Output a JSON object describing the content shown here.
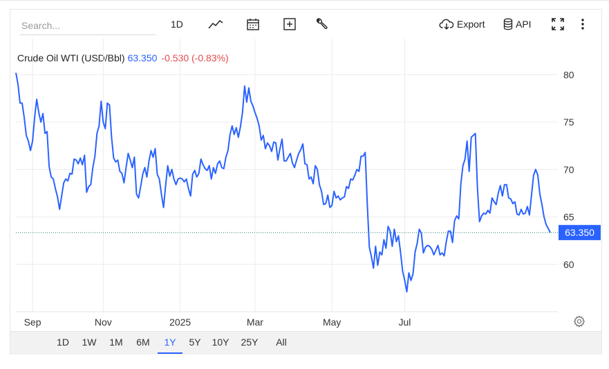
{
  "toolbar": {
    "search_placeholder": "Search...",
    "interval_label": "1D",
    "export_label": "Export",
    "api_label": "API",
    "icons": [
      "line-chart-icon",
      "calendar-icon",
      "add-indicator-icon",
      "wrench-icon",
      "cloud-download-icon",
      "database-icon",
      "fullscreen-icon",
      "more-vertical-icon"
    ]
  },
  "legend": {
    "name": "Crude Oil WTI (USD/Bbl)",
    "price": "63.350",
    "change": "-0.530 (-0.83%)"
  },
  "colors": {
    "line": "#2962ff",
    "down": "#e5484d",
    "grid": "#ececec",
    "last_price_tag": "#2962ff"
  },
  "ranges": {
    "items": [
      "1D",
      "1W",
      "1M",
      "6M",
      "1Y",
      "5Y",
      "10Y",
      "25Y",
      "All"
    ],
    "active": "1Y"
  },
  "chart_data": {
    "type": "line",
    "title": "",
    "xlabel": "",
    "ylabel": "",
    "y_ticks": [
      60,
      65,
      70,
      75,
      80
    ],
    "ylim": [
      55,
      83.8
    ],
    "x_tick_labels": [
      "Sep",
      "Nov",
      "2025",
      "Mar",
      "May",
      "Jul"
    ],
    "last_value": 63.35,
    "last_value_label": "63.350",
    "grid": true,
    "series": [
      {
        "values": [
          80.2,
          79.0,
          77.0,
          77.0,
          75.5,
          73.6,
          73.0,
          72.0,
          73.0,
          75.5,
          77.4,
          76.0,
          75.0,
          75.9,
          73.8,
          74.0,
          70.3,
          69.2,
          69.0,
          68.0,
          67.1,
          65.8,
          67.2,
          68.6,
          69.0,
          68.8,
          69.6,
          69.5,
          71.1,
          71.0,
          70.6,
          71.2,
          70.5,
          71.5,
          67.6,
          68.2,
          68.4,
          70.2,
          71.4,
          73.8,
          74.6,
          77.2,
          75.0,
          74.3,
          77.0,
          76.8,
          73.4,
          71.2,
          70.8,
          71.0,
          69.8,
          69.6,
          68.6,
          70.2,
          71.7,
          71.0,
          70.2,
          71.3,
          67.4,
          67.0,
          68.2,
          69.5,
          70.2,
          69.2,
          70.9,
          72.0,
          71.3,
          72.2,
          69.5,
          69.0,
          67.4,
          66.0,
          68.3,
          70.4,
          69.3,
          70.0,
          69.0,
          68.4,
          69.0,
          69.1,
          69.0,
          68.7,
          69.0,
          68.0,
          67.2,
          69.5,
          69.9,
          69.2,
          69.6,
          71.1,
          70.5,
          70.1,
          69.9,
          70.4,
          69.0,
          70.2,
          69.6,
          70.6,
          70.9,
          70.2,
          70.1,
          71.3,
          72.0,
          73.7,
          74.6,
          73.7,
          74.4,
          73.4,
          74.5,
          76.0,
          78.8,
          77.1,
          78.6,
          77.2,
          76.7,
          76.0,
          75.4,
          74.6,
          73.1,
          73.6,
          72.2,
          72.8,
          72.5,
          71.9,
          72.9,
          72.8,
          71.0,
          72.2,
          73.2,
          70.9,
          70.9,
          71.3,
          71.7,
          70.7,
          70.2,
          71.0,
          71.7,
          72.1,
          72.7,
          70.6,
          70.5,
          69.0,
          69.2,
          68.5,
          70.4,
          70.0,
          68.4,
          67.7,
          66.3,
          66.4,
          67.3,
          66.0,
          66.2,
          67.7,
          67.0,
          67.2,
          66.8,
          67.0,
          67.1,
          68.2,
          68.0,
          69.0,
          68.9,
          69.4,
          70.0,
          69.8,
          71.4,
          71.4,
          71.8,
          66.4,
          61.8,
          60.8,
          59.6,
          61.9,
          59.9,
          61.3,
          61.0,
          62.6,
          61.7,
          64.0,
          63.5,
          61.9,
          63.7,
          62.4,
          63.0,
          61.3,
          59.3,
          58.3,
          57.1,
          59.1,
          58.3,
          59.0,
          61.3,
          62.2,
          63.7,
          63.3,
          61.2,
          61.8,
          62.0,
          61.9,
          61.6,
          61.0,
          61.5,
          62.0,
          61.0,
          61.2,
          60.9,
          62.4,
          63.5,
          63.5,
          62.3,
          64.6,
          65.1,
          64.8,
          68.5,
          70.4,
          71.1,
          73.0,
          69.8,
          73.4,
          73.6,
          73.8,
          68.0,
          64.5,
          65.1,
          65.4,
          65.3,
          65.7,
          65.4,
          67.0,
          66.6,
          66.3,
          67.5,
          68.3,
          67.2,
          68.4,
          68.4,
          67.0,
          66.9,
          66.4,
          66.6,
          65.3,
          65.2,
          65.8,
          65.3,
          65.4,
          66.1,
          65.2,
          67.3,
          69.4,
          70.0,
          69.4,
          67.4,
          66.3,
          65.0,
          64.2,
          63.8,
          63.35
        ]
      }
    ]
  }
}
